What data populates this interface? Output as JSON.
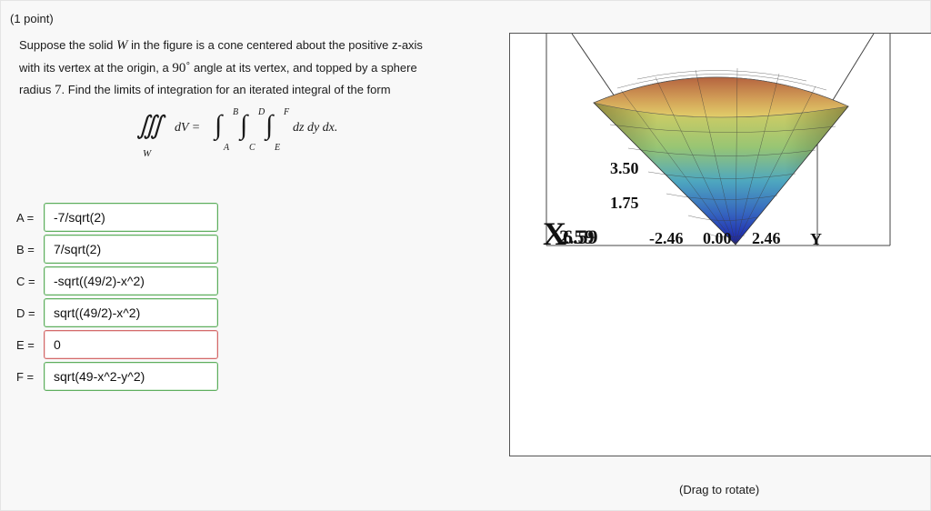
{
  "problem": {
    "points_label": "(1 point)",
    "line1_a": "Suppose the solid ",
    "line1_var": "W",
    "line1_b": " in the figure is a cone centered about the positive z-axis",
    "line2_a": "with its vertex at the origin, a ",
    "line2_angle": "90˚",
    "line2_b": " angle at its vertex, and topped by a sphere",
    "line3_a": "radius ",
    "line3_radius": "7",
    "line3_b": ". Find the limits of integration for an iterated integral of the form"
  },
  "formula": {
    "triple_integral": "∭",
    "region": "W",
    "dv_eq": "dV =",
    "int_sign": "∫",
    "upper_1": "B",
    "lower_1": "A",
    "upper_2": "D",
    "lower_2": "C",
    "upper_3": "F",
    "lower_3": "E",
    "differentials": "dz dy dx."
  },
  "answers": [
    {
      "label": "A =",
      "value": "-7/sqrt(2)",
      "status": "correct"
    },
    {
      "label": "B =",
      "value": "7/sqrt(2)",
      "status": "correct"
    },
    {
      "label": "C =",
      "value": "-sqrt((49/2)-x^2)",
      "status": "correct"
    },
    {
      "label": "D =",
      "value": "sqrt((49/2)-x^2)",
      "status": "correct"
    },
    {
      "label": "E =",
      "value": "0",
      "status": "incorrect"
    },
    {
      "label": "F =",
      "value": "sqrt(49-x^2-y^2)",
      "status": "correct"
    }
  ],
  "graph": {
    "z_tick_1": "3.50",
    "z_tick_2": "1.75",
    "x_axis_label": "X",
    "x_overlap_label": "2.59",
    "x_overlap_label_2": "6.59",
    "y_tick_neg": "-2.46",
    "origin_tick": "0.00",
    "y_tick_pos": "2.46",
    "y_axis_label": "Y",
    "colors": {
      "top": "#c08a55",
      "mid": "#e0d46a",
      "lower": "#4fa6c9",
      "vertex": "#1a22b8"
    }
  },
  "drag_caption": "(Drag to rotate)"
}
